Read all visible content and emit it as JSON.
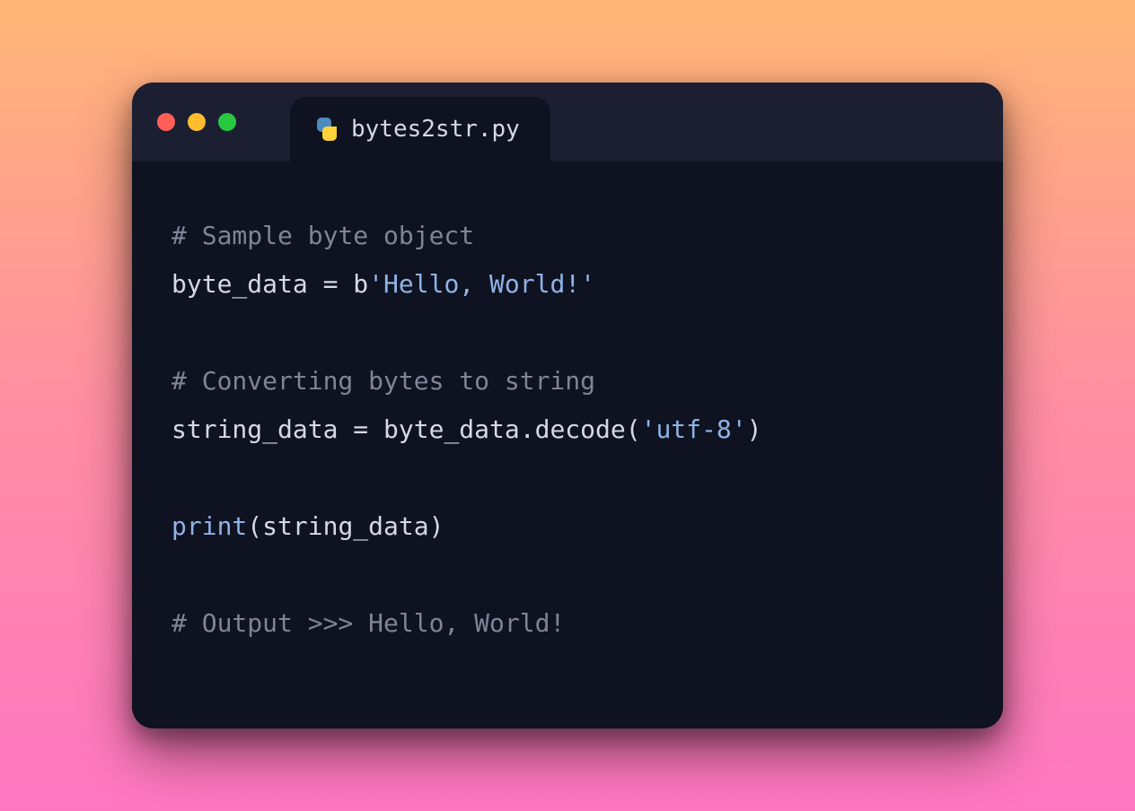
{
  "tab": {
    "filename": "bytes2str.py"
  },
  "code": {
    "line1_comment": "# Sample byte object",
    "line2_var": "byte_data ",
    "line2_eq": "=",
    "line2_b": " b",
    "line2_str": "'Hello, World!'",
    "line4_comment": "# Converting bytes to string",
    "line5_var": "string_data ",
    "line5_eq": "=",
    "line5_rest1": " byte_data.decode(",
    "line5_str": "'utf-8'",
    "line5_rest2": ")",
    "line7_print": "print",
    "line7_args": "(string_data)",
    "line9_comment": "# Output >>> Hello, World!"
  }
}
